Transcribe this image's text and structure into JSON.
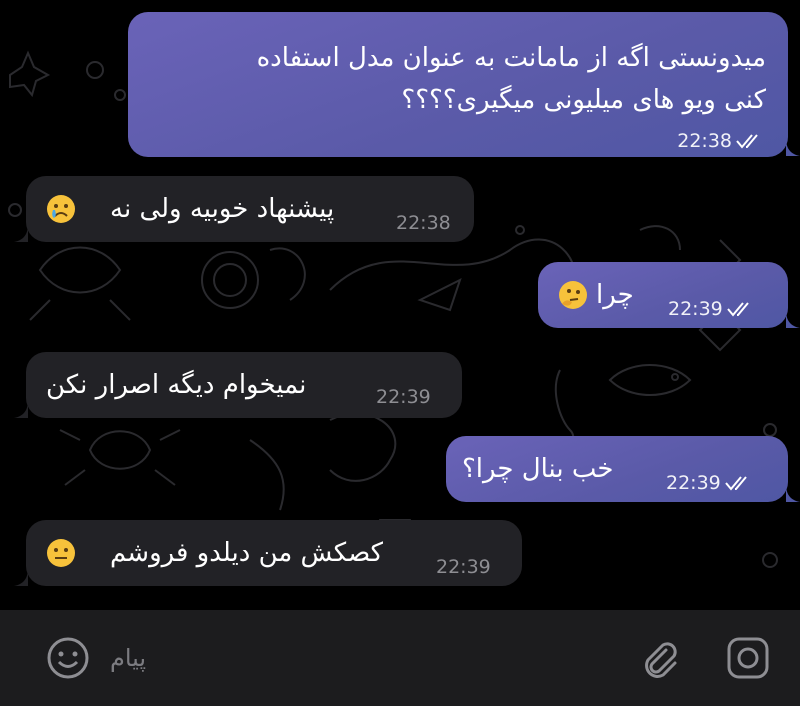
{
  "messages": [
    {
      "dir": "out",
      "text_line1": "میدونستی اگه از مامانت به عنوان مدل استفاده",
      "text_line2": "کنی ویو های میلیونی میگیری؟؟؟؟",
      "time": "22:38",
      "status": "read"
    },
    {
      "dir": "in",
      "text": "پیشنهاد خوبیه ولی نه",
      "emoji": "crying-face",
      "time": "22:38"
    },
    {
      "dir": "out",
      "text": "چرا",
      "emoji": "thinking-face",
      "time": "22:39",
      "status": "read"
    },
    {
      "dir": "in",
      "text": "نمیخوام دیگه اصرار نکن",
      "time": "22:39"
    },
    {
      "dir": "out",
      "text": "خب بنال چرا؟",
      "time": "22:39",
      "status": "read"
    },
    {
      "dir": "in",
      "text": "کصکش من دیلدو فروشم",
      "emoji": "neutral-face",
      "time": "22:39"
    }
  ],
  "composer": {
    "placeholder": "پیام"
  },
  "colors": {
    "outgoing_bubble": "#5f5db0",
    "incoming_bubble": "#222226",
    "composer_bg": "#1c1c1e",
    "background": "#000000"
  }
}
